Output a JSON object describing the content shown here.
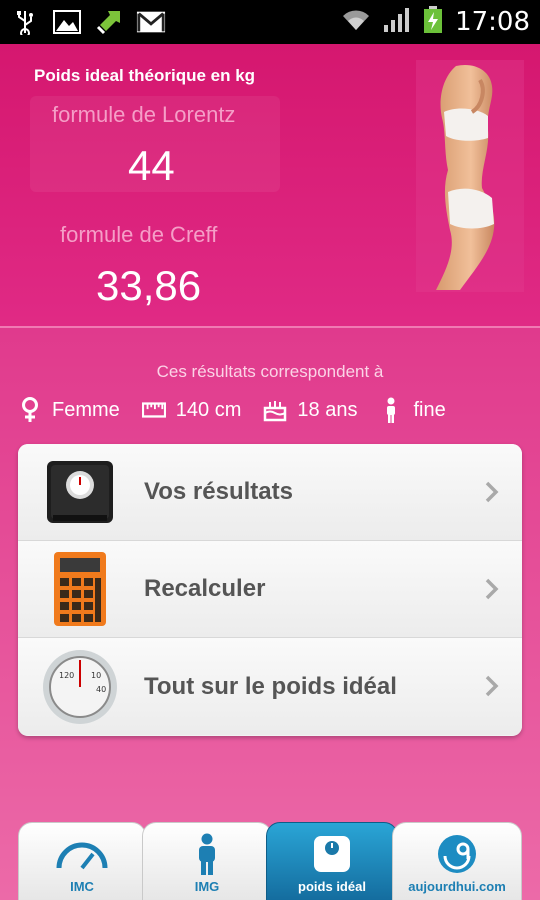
{
  "status_bar": {
    "time": "17:08",
    "icons": [
      "usb-icon",
      "image-icon",
      "sync-icon",
      "gmail-icon",
      "wifi-icon",
      "signal-icon",
      "battery-icon"
    ]
  },
  "header": {
    "title": "Poids ideal théorique en kg",
    "lorentz_label": "formule de Lorentz",
    "lorentz_value": "44",
    "creff_label": "formule de Creff",
    "creff_value": "33,86"
  },
  "summary": {
    "intro": "Ces résultats correspondent à",
    "gender": "Femme",
    "height": "140 cm",
    "age": "18 ans",
    "morphology": "fine"
  },
  "menu": {
    "items": [
      {
        "label": "Vos résultats",
        "icon": "bathroom-scale-icon"
      },
      {
        "label": "Recalculer",
        "icon": "calculator-icon"
      },
      {
        "label": "Tout sur le poids idéal",
        "icon": "dial-scale-icon"
      }
    ]
  },
  "tabs": [
    {
      "label": "IMC",
      "icon": "gauge-icon",
      "active": false
    },
    {
      "label": "IMG",
      "icon": "person-icon",
      "active": false
    },
    {
      "label": "poids idéal",
      "icon": "scale-icon",
      "active": true
    },
    {
      "label": "aujourdhui.com",
      "icon": "aujourdhui-logo-icon",
      "active": false
    }
  ],
  "colors": {
    "background": "#d81b7a",
    "accent_pink_label": "#f59ec7",
    "tab_active": "#1d8cc2",
    "tab_text": "#1d7fb3"
  }
}
